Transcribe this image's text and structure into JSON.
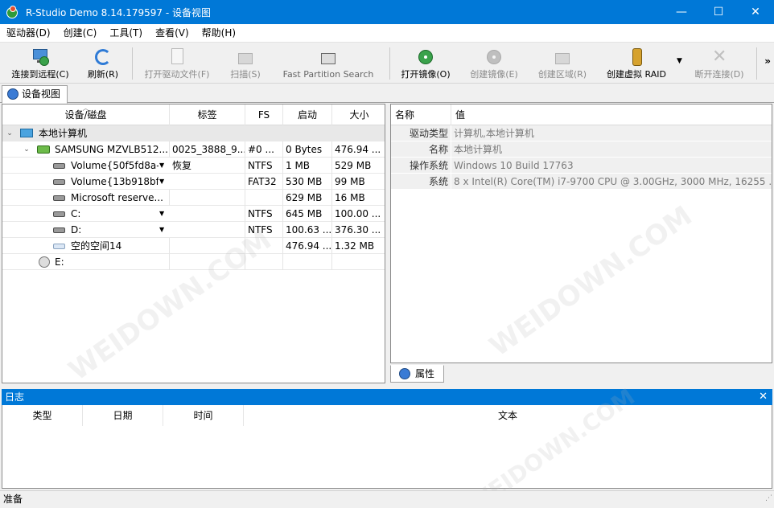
{
  "window": {
    "title": "R-Studio Demo 8.14.179597 - 设备视图",
    "minimize": "—",
    "maximize": "☐",
    "close": "✕"
  },
  "menu": [
    "驱动器(D)",
    "创建(C)",
    "工具(T)",
    "查看(V)",
    "帮助(H)"
  ],
  "toolbar": {
    "connect": "连接到远程(C)",
    "refresh": "刷新(R)",
    "open_drive_files": "打开驱动文件(F)",
    "scan": "扫描(S)",
    "fast_partition_search": "Fast Partition Search",
    "open_image": "打开镜像(O)",
    "create_image": "创建镜像(E)",
    "create_region": "创建区域(R)",
    "create_virtual_raid": "创建虚拟 RAID",
    "disconnect": "断开连接(D)",
    "more": "»"
  },
  "tabs": {
    "device_view": "设备视图",
    "properties": "属性"
  },
  "device_grid": {
    "columns": [
      "设备/磁盘",
      "标签",
      "FS",
      "启动",
      "大小"
    ],
    "rows": [
      {
        "name": "本地计算机",
        "label": "",
        "fs": "",
        "start": "",
        "size": ""
      },
      {
        "name": "SAMSUNG MZVLB512...",
        "label": "0025_3888_9...",
        "fs": "#0 ...",
        "start": "0 Bytes",
        "size": "476.94 ..."
      },
      {
        "name": "Volume{50f5fd8a-...",
        "label": "恢复",
        "fs": "NTFS",
        "start": "1 MB",
        "size": "529 MB"
      },
      {
        "name": "Volume{13b918bf-...",
        "label": "",
        "fs": "FAT32",
        "start": "530 MB",
        "size": "99 MB"
      },
      {
        "name": "Microsoft reserve...",
        "label": "",
        "fs": "",
        "start": "629 MB",
        "size": "16 MB"
      },
      {
        "name": "C:",
        "label": "",
        "fs": "NTFS",
        "start": "645 MB",
        "size": "100.00 ..."
      },
      {
        "name": "D:",
        "label": "",
        "fs": "NTFS",
        "start": "100.63 ...",
        "size": "376.30 ..."
      },
      {
        "name": "空的空间14",
        "label": "",
        "fs": "",
        "start": "476.94 ...",
        "size": "1.32 MB"
      },
      {
        "name": "E:",
        "label": "",
        "fs": "",
        "start": "",
        "size": ""
      }
    ]
  },
  "properties": {
    "columns": [
      "名称",
      "值"
    ],
    "rows": [
      {
        "key": "驱动类型",
        "value": "计算机,本地计算机"
      },
      {
        "key": "名称",
        "value": "本地计算机"
      },
      {
        "key": "操作系统",
        "value": "Windows 10 Build 17763"
      },
      {
        "key": "系统",
        "value": "8 x Intel(R) Core(TM) i7-9700 CPU @ 3.00GHz, 3000 MHz, 16255 ..."
      }
    ]
  },
  "log": {
    "title": "日志",
    "close": "✕",
    "columns": [
      "类型",
      "日期",
      "时间",
      "文本"
    ]
  },
  "status": {
    "text": "准备"
  },
  "watermark": "WEIDOWN.COM",
  "colors": {
    "accent": "#0078d7"
  }
}
